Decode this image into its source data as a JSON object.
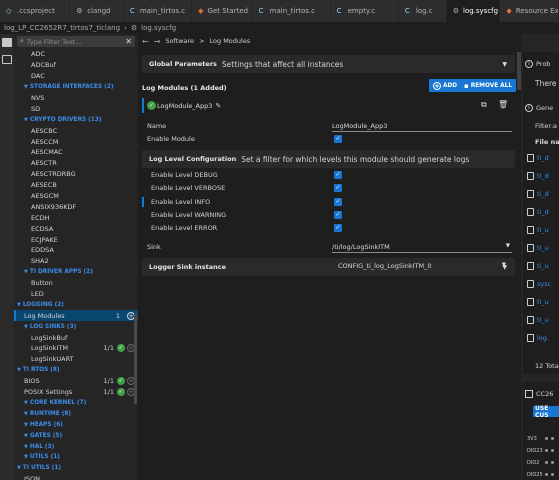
{
  "tabs": [
    {
      "label": ".ccsproject",
      "icon": "xml-file-icon",
      "active": false
    },
    {
      "label": "clangd",
      "icon": "gear-icon",
      "active": false
    },
    {
      "label": "main_tirtos.c",
      "icon": "c-file-icon",
      "active": false
    },
    {
      "label": "Get Started",
      "icon": "ti-logo-icon",
      "active": false
    },
    {
      "label": "main_tirtos.c",
      "icon": "c-file-icon",
      "active": false
    },
    {
      "label": "empty.c",
      "icon": "c-file-icon",
      "active": false
    },
    {
      "label": "log.c",
      "icon": "c-file-icon",
      "active": false
    },
    {
      "label": "log.syscfg",
      "icon": "gear-icon",
      "active": true
    },
    {
      "label": "Resource Exp",
      "icon": "ti-logo-icon",
      "active": false
    }
  ],
  "breadcrumbs": [
    "log_LP_CC2652R7_tirtos7_ticlang",
    "log.syscfg"
  ],
  "sidebar": {
    "filter_placeholder": "Type Filter Text...",
    "tree": [
      {
        "label": "ADC",
        "type": "item",
        "indent": 2
      },
      {
        "label": "ADCBuf",
        "type": "item",
        "indent": 2
      },
      {
        "label": "DAC",
        "type": "item",
        "indent": 2
      },
      {
        "label": "STORAGE INTERFACES (2)",
        "type": "cat",
        "indent": 1
      },
      {
        "label": "NVS",
        "type": "item",
        "indent": 2
      },
      {
        "label": "SD",
        "type": "item",
        "indent": 2
      },
      {
        "label": "CRYPTO DRIVERS (13)",
        "type": "cat",
        "indent": 1
      },
      {
        "label": "AESCBC",
        "type": "item",
        "indent": 2
      },
      {
        "label": "AESCCM",
        "type": "item",
        "indent": 2
      },
      {
        "label": "AESCMAC",
        "type": "item",
        "indent": 2
      },
      {
        "label": "AESCTR",
        "type": "item",
        "indent": 2
      },
      {
        "label": "AESCTRDRBG",
        "type": "item",
        "indent": 2
      },
      {
        "label": "AESECB",
        "type": "item",
        "indent": 2
      },
      {
        "label": "AESGCM",
        "type": "item",
        "indent": 2
      },
      {
        "label": "ANSIX936KDF",
        "type": "item",
        "indent": 2
      },
      {
        "label": "ECDH",
        "type": "item",
        "indent": 2
      },
      {
        "label": "ECDSA",
        "type": "item",
        "indent": 2
      },
      {
        "label": "ECJPAKE",
        "type": "item",
        "indent": 2
      },
      {
        "label": "EDDSA",
        "type": "item",
        "indent": 2
      },
      {
        "label": "SHA2",
        "type": "item",
        "indent": 2
      },
      {
        "label": "TI DRIVER APPS (2)",
        "type": "cat",
        "indent": 1
      },
      {
        "label": "Button",
        "type": "item",
        "indent": 2
      },
      {
        "label": "LED",
        "type": "item",
        "indent": 2
      },
      {
        "label": "LOGGING (2)",
        "type": "cat",
        "indent": 0
      },
      {
        "label": "Log Modules",
        "type": "item",
        "indent": 1,
        "count": "1",
        "ok": true,
        "add": true,
        "selected": true
      },
      {
        "label": "LOG SINKS (3)",
        "type": "cat",
        "indent": 1
      },
      {
        "label": "LogSinkBuf",
        "type": "item",
        "indent": 2
      },
      {
        "label": "LogSinkITM",
        "type": "item",
        "indent": 2,
        "count": "1/1",
        "ok": true,
        "add_dim": true
      },
      {
        "label": "LogSinkUART",
        "type": "item",
        "indent": 2
      },
      {
        "label": "TI RTOS (8)",
        "type": "cat",
        "indent": 0
      },
      {
        "label": "BIOS",
        "type": "item",
        "indent": 1,
        "count": "1/1",
        "ok": true,
        "add_dim": true
      },
      {
        "label": "POSIX Settings",
        "type": "item",
        "indent": 1,
        "count": "1/1",
        "ok": true,
        "add_dim": true
      },
      {
        "label": "CORE KERNEL (7)",
        "type": "cat",
        "indent": 1
      },
      {
        "label": "RUNTIME (8)",
        "type": "cat",
        "indent": 1
      },
      {
        "label": "HEAPS (6)",
        "type": "cat",
        "indent": 1
      },
      {
        "label": "GATES (5)",
        "type": "cat",
        "indent": 1
      },
      {
        "label": "HAL (3)",
        "type": "cat",
        "indent": 1
      },
      {
        "label": "UTILS (1)",
        "type": "cat",
        "indent": 1
      },
      {
        "label": "TI UTILS (1)",
        "type": "cat",
        "indent": 0
      },
      {
        "label": "JSON",
        "type": "item",
        "indent": 1
      }
    ]
  },
  "main": {
    "nav": {
      "category": "Software",
      "sep": ">",
      "page": "Log Modules"
    },
    "global_params": {
      "title": "Global Parameters",
      "desc": "Settings that affect all instances"
    },
    "module_header": "Log Modules (1 Added)",
    "add_label": "ADD",
    "remove_all_label": "REMOVE ALL",
    "instance_name": "LogModule_App3",
    "fields": {
      "name_label": "Name",
      "name_value": "LogModule_App3",
      "enable_module_label": "Enable Module"
    },
    "log_level": {
      "title": "Log Level Configuration",
      "desc": "Set a filter for which levels this module should generate logs",
      "levels": [
        {
          "label": "Enable Level DEBUG",
          "checked": true
        },
        {
          "label": "Enable Level VERBOSE",
          "checked": true
        },
        {
          "label": "Enable Level INFO",
          "checked": true,
          "highlight": true
        },
        {
          "label": "Enable Level WARNING",
          "checked": true
        },
        {
          "label": "Enable Level ERROR",
          "checked": true
        }
      ]
    },
    "sink_label": "Sink",
    "sink_value": "/ti/log/LogSinkITM",
    "logger_sink": {
      "title": "Logger Sink instance",
      "value": "CONFIG_ti_log_LogSinkITM_0"
    }
  },
  "right_panel": {
    "problems_title": "Prob",
    "problems_text": "There a",
    "generated_title": "Gene",
    "filter_label": "Filter:",
    "filter_value": "a",
    "file_name_header": "File nam",
    "files": [
      "ti_d",
      "ti_d",
      "ti_d",
      "ti_d",
      "ti_u",
      "ti_u",
      "ti_u",
      "sysc",
      "ti_u",
      "ti_u",
      "log."
    ],
    "total": "12 Total",
    "device_title": "CC26",
    "use_custom_label": "USE CUS",
    "pins": [
      "3V3",
      "DIO23",
      "DIO2",
      "DIO25"
    ]
  }
}
